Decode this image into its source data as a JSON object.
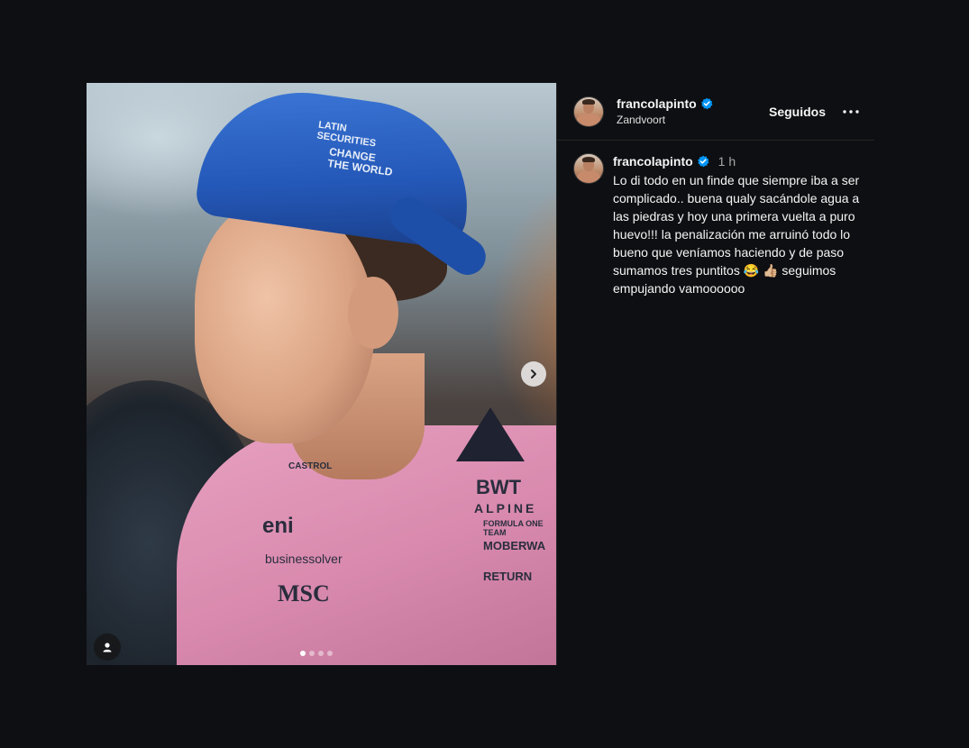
{
  "post": {
    "author": {
      "username": "francolapinto",
      "location": "Zandvoort",
      "verified": true
    },
    "follow_label": "Seguidos",
    "more_icon": "more-horizontal-icon",
    "caption": {
      "timestamp": "1 h",
      "text": "Lo di todo en un finde que siempre iba a ser complicado.. buena qualy sacándole agua a las piedras y hoy una primera vuelta a puro huevo!!! la penalización me arruinó todo lo bueno que veníamos haciendo y de paso sumamos tres puntitos 😂 👍🏼 seguimos empujando vamoooooo"
    },
    "media": {
      "carousel_dots": 4,
      "active_index": 0,
      "next_icon": "chevron-right-icon",
      "tag_icon": "user-tag-icon",
      "photo_text": {
        "cap_line1": "LATIN\nSECURITIES",
        "cap_line2": "CHANGE\nTHE WORLD",
        "eni": "eni",
        "businessolver": "businessolver",
        "msc": "MSC",
        "castrol": "CASTROL",
        "bwt": "BWT",
        "alpine": "ALPINE",
        "formula_one_team": "FORMULA ONE TEAM",
        "moberly": "MOBERWA",
        "return": "RETURN"
      }
    },
    "colors": {
      "background": "#0d0f12",
      "verified_blue": "#0095f6",
      "secondary_text": "#a8a8a8"
    }
  }
}
